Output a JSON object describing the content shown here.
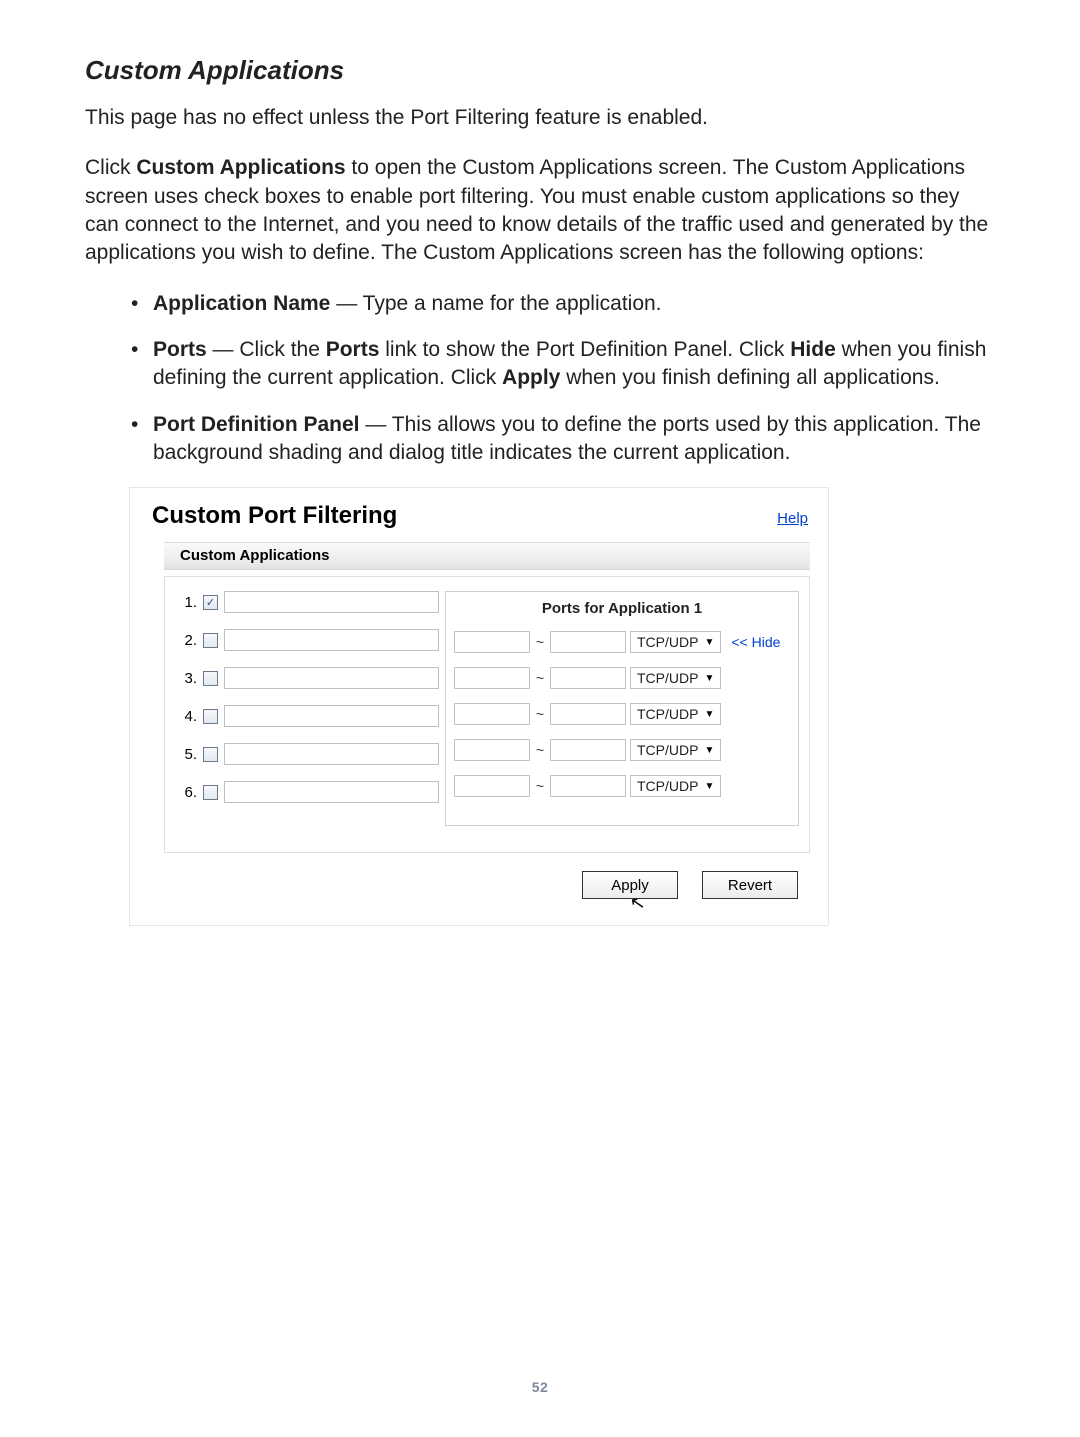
{
  "doc": {
    "section_title": "Custom Applications",
    "intro_sentence": "This page has no effect unless the Port Filtering feature is enabled.",
    "para2_prefix": "Click ",
    "para2_bold": "Custom Applications",
    "para2_rest": " to open the Custom Applications screen. The Custom Applications screen uses check boxes to enable port filtering. You must enable custom applications so they can connect to the Internet, and you need to know details of the traffic used and generated by the applications you wish to define. The Custom Applications screen has the following options:",
    "bullets": {
      "b1_bold": "Application Name",
      "b1_rest": " — Type a name for the application.",
      "b2_bold1": "Ports",
      "b2_mid1": " — Click the ",
      "b2_bold2": "Ports",
      "b2_mid2": " link to show the Port Definition Panel. Click ",
      "b2_bold3": "Hide",
      "b2_mid3": " when you finish defining the current application. Click ",
      "b2_bold4": "Apply",
      "b2_mid4": " when you finish defining all applications.",
      "b3_bold": "Port Definition Panel",
      "b3_rest": " — This allows you to define the ports used by this application. The background shading and dialog title indicates the current application."
    },
    "page_number": "52"
  },
  "panel": {
    "title": "Custom Port Filtering",
    "help": "Help",
    "subheader": "Custom Applications",
    "app_rows": [
      {
        "num": "1.",
        "checked": true
      },
      {
        "num": "2.",
        "checked": false
      },
      {
        "num": "3.",
        "checked": false
      },
      {
        "num": "4.",
        "checked": false
      },
      {
        "num": "5.",
        "checked": false
      },
      {
        "num": "6.",
        "checked": false
      }
    ],
    "ports_title": "Ports for Application 1",
    "tilde": "~",
    "protocol_label": "TCP/UDP",
    "hide_label": "<< Hide",
    "port_rows_count": 5,
    "buttons": {
      "apply": "Apply",
      "revert": "Revert"
    }
  }
}
